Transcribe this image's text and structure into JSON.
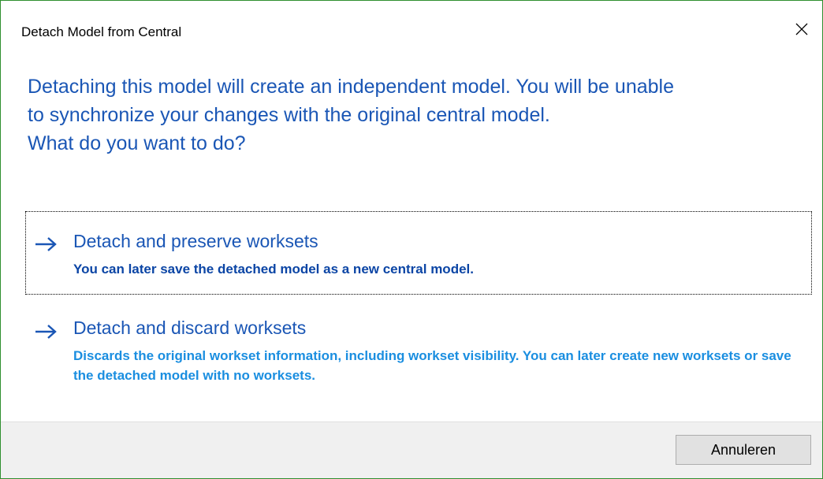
{
  "window": {
    "title": "Detach Model from Central",
    "close_icon": "close-icon"
  },
  "instruction": {
    "line1": "Detaching this model will create an independent model. You will be unable",
    "line2": "to synchronize your changes with the original central model.",
    "line3": "What do you want to do?"
  },
  "options": [
    {
      "icon": "arrow-right-icon",
      "title": "Detach and preserve worksets",
      "description": "You can later save the detached model as a new central model.",
      "focused": true
    },
    {
      "icon": "arrow-right-icon",
      "title": "Detach and discard worksets",
      "description": "Discards the original workset information, including workset visibility. You can later create new worksets or save the detached model with no worksets.",
      "focused": false
    }
  ],
  "footer": {
    "cancel_label": "Annuleren"
  },
  "colors": {
    "instruction_text": "#1a56b5",
    "option_title": "#1a56b5",
    "option1_desc": "#0b45a5",
    "option2_desc": "#1a8ee0",
    "window_border": "#2f8f2f",
    "footer_bg": "#f0f0f0"
  }
}
